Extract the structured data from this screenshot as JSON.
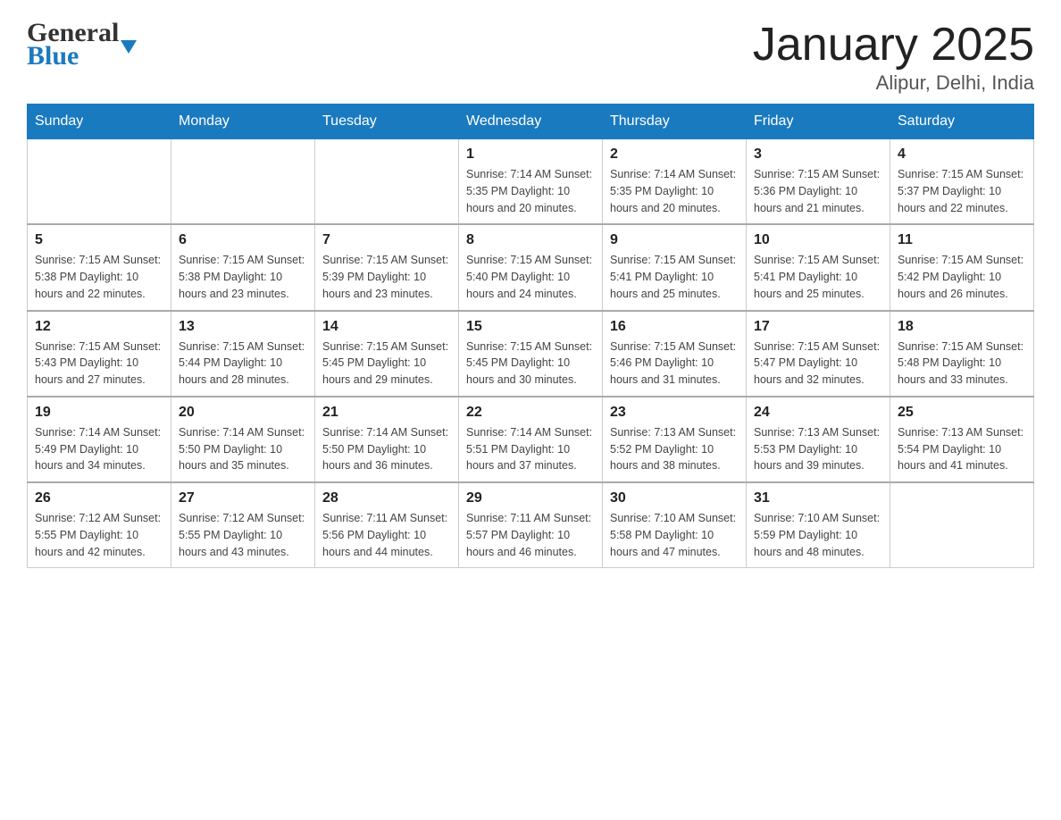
{
  "header": {
    "logo_line1": "General",
    "logo_line2": "Blue",
    "title": "January 2025",
    "subtitle": "Alipur, Delhi, India"
  },
  "calendar": {
    "days_of_week": [
      "Sunday",
      "Monday",
      "Tuesday",
      "Wednesday",
      "Thursday",
      "Friday",
      "Saturday"
    ],
    "weeks": [
      [
        {
          "day": "",
          "info": ""
        },
        {
          "day": "",
          "info": ""
        },
        {
          "day": "",
          "info": ""
        },
        {
          "day": "1",
          "info": "Sunrise: 7:14 AM\nSunset: 5:35 PM\nDaylight: 10 hours\nand 20 minutes."
        },
        {
          "day": "2",
          "info": "Sunrise: 7:14 AM\nSunset: 5:35 PM\nDaylight: 10 hours\nand 20 minutes."
        },
        {
          "day": "3",
          "info": "Sunrise: 7:15 AM\nSunset: 5:36 PM\nDaylight: 10 hours\nand 21 minutes."
        },
        {
          "day": "4",
          "info": "Sunrise: 7:15 AM\nSunset: 5:37 PM\nDaylight: 10 hours\nand 22 minutes."
        }
      ],
      [
        {
          "day": "5",
          "info": "Sunrise: 7:15 AM\nSunset: 5:38 PM\nDaylight: 10 hours\nand 22 minutes."
        },
        {
          "day": "6",
          "info": "Sunrise: 7:15 AM\nSunset: 5:38 PM\nDaylight: 10 hours\nand 23 minutes."
        },
        {
          "day": "7",
          "info": "Sunrise: 7:15 AM\nSunset: 5:39 PM\nDaylight: 10 hours\nand 23 minutes."
        },
        {
          "day": "8",
          "info": "Sunrise: 7:15 AM\nSunset: 5:40 PM\nDaylight: 10 hours\nand 24 minutes."
        },
        {
          "day": "9",
          "info": "Sunrise: 7:15 AM\nSunset: 5:41 PM\nDaylight: 10 hours\nand 25 minutes."
        },
        {
          "day": "10",
          "info": "Sunrise: 7:15 AM\nSunset: 5:41 PM\nDaylight: 10 hours\nand 25 minutes."
        },
        {
          "day": "11",
          "info": "Sunrise: 7:15 AM\nSunset: 5:42 PM\nDaylight: 10 hours\nand 26 minutes."
        }
      ],
      [
        {
          "day": "12",
          "info": "Sunrise: 7:15 AM\nSunset: 5:43 PM\nDaylight: 10 hours\nand 27 minutes."
        },
        {
          "day": "13",
          "info": "Sunrise: 7:15 AM\nSunset: 5:44 PM\nDaylight: 10 hours\nand 28 minutes."
        },
        {
          "day": "14",
          "info": "Sunrise: 7:15 AM\nSunset: 5:45 PM\nDaylight: 10 hours\nand 29 minutes."
        },
        {
          "day": "15",
          "info": "Sunrise: 7:15 AM\nSunset: 5:45 PM\nDaylight: 10 hours\nand 30 minutes."
        },
        {
          "day": "16",
          "info": "Sunrise: 7:15 AM\nSunset: 5:46 PM\nDaylight: 10 hours\nand 31 minutes."
        },
        {
          "day": "17",
          "info": "Sunrise: 7:15 AM\nSunset: 5:47 PM\nDaylight: 10 hours\nand 32 minutes."
        },
        {
          "day": "18",
          "info": "Sunrise: 7:15 AM\nSunset: 5:48 PM\nDaylight: 10 hours\nand 33 minutes."
        }
      ],
      [
        {
          "day": "19",
          "info": "Sunrise: 7:14 AM\nSunset: 5:49 PM\nDaylight: 10 hours\nand 34 minutes."
        },
        {
          "day": "20",
          "info": "Sunrise: 7:14 AM\nSunset: 5:50 PM\nDaylight: 10 hours\nand 35 minutes."
        },
        {
          "day": "21",
          "info": "Sunrise: 7:14 AM\nSunset: 5:50 PM\nDaylight: 10 hours\nand 36 minutes."
        },
        {
          "day": "22",
          "info": "Sunrise: 7:14 AM\nSunset: 5:51 PM\nDaylight: 10 hours\nand 37 minutes."
        },
        {
          "day": "23",
          "info": "Sunrise: 7:13 AM\nSunset: 5:52 PM\nDaylight: 10 hours\nand 38 minutes."
        },
        {
          "day": "24",
          "info": "Sunrise: 7:13 AM\nSunset: 5:53 PM\nDaylight: 10 hours\nand 39 minutes."
        },
        {
          "day": "25",
          "info": "Sunrise: 7:13 AM\nSunset: 5:54 PM\nDaylight: 10 hours\nand 41 minutes."
        }
      ],
      [
        {
          "day": "26",
          "info": "Sunrise: 7:12 AM\nSunset: 5:55 PM\nDaylight: 10 hours\nand 42 minutes."
        },
        {
          "day": "27",
          "info": "Sunrise: 7:12 AM\nSunset: 5:55 PM\nDaylight: 10 hours\nand 43 minutes."
        },
        {
          "day": "28",
          "info": "Sunrise: 7:11 AM\nSunset: 5:56 PM\nDaylight: 10 hours\nand 44 minutes."
        },
        {
          "day": "29",
          "info": "Sunrise: 7:11 AM\nSunset: 5:57 PM\nDaylight: 10 hours\nand 46 minutes."
        },
        {
          "day": "30",
          "info": "Sunrise: 7:10 AM\nSunset: 5:58 PM\nDaylight: 10 hours\nand 47 minutes."
        },
        {
          "day": "31",
          "info": "Sunrise: 7:10 AM\nSunset: 5:59 PM\nDaylight: 10 hours\nand 48 minutes."
        },
        {
          "day": "",
          "info": ""
        }
      ]
    ]
  }
}
